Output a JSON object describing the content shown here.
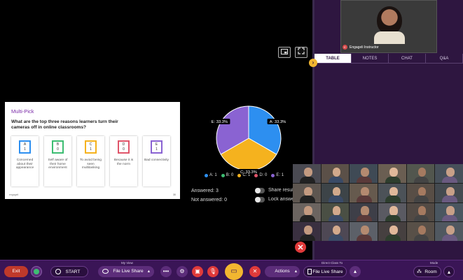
{
  "colors": {
    "background": "#000000",
    "panel": "#2e1640",
    "bottom_bar": "#3a1556",
    "accent_purple": "#7b2ca8",
    "exit_red": "#c0392b",
    "chart_blue": "#2d8ff0",
    "chart_yellow": "#f5b21e",
    "chart_purple": "#8a63d2",
    "chart_green": "#3dbd72",
    "chart_red": "#e0556a"
  },
  "instructor": {
    "name": "Engageli Instructor",
    "initial": "E"
  },
  "tabs": [
    {
      "label": "TABLE",
      "active": true
    },
    {
      "label": "NOTES",
      "active": false
    },
    {
      "label": "CHAT",
      "active": false
    },
    {
      "label": "Q&A",
      "active": false
    }
  ],
  "slide": {
    "title": "Multi-Pick",
    "question": "What are the top three reasons learners turn their cameras off in online classrooms?",
    "cards": [
      {
        "letter": "A",
        "count": "1",
        "text": "Concerned about their appearance",
        "color": "#2d8ff0"
      },
      {
        "letter": "B",
        "count": "0",
        "text": "Self aware of their home environment",
        "color": "#3dbd72"
      },
      {
        "letter": "C",
        "count": "1",
        "text": "To avoid being seen multitasking",
        "color": "#f5b21e"
      },
      {
        "letter": "D",
        "count": "0",
        "text": "Because it is the norm",
        "color": "#e0556a"
      },
      {
        "letter": "E",
        "count": "1",
        "text": "Bad connectivity",
        "color": "#8a63d2"
      }
    ],
    "footer_left": "engageli",
    "footer_right": "30"
  },
  "chart_data": {
    "type": "pie",
    "categories": [
      "A",
      "B",
      "C",
      "D",
      "E"
    ],
    "values": [
      33.3,
      0,
      33.3,
      0,
      33.3
    ],
    "slice_labels": [
      "A: 33.3%",
      "",
      "C: 33.3%",
      "",
      "E: 33.3%"
    ],
    "legend": [
      "A: 1",
      "B: 0",
      "C: 1",
      "D: 0",
      "E: 1"
    ],
    "legend_colors": [
      "#2d8ff0",
      "#3dbd72",
      "#f5b21e",
      "#e0556a",
      "#8a63d2"
    ],
    "legend_position": "bottom"
  },
  "stats": {
    "answered": "Answered: 3",
    "not_answered": "Not answered: 0"
  },
  "toggles": {
    "share": "Share results",
    "lock": "Lock answers"
  },
  "bottom_bar": {
    "exit": "Exit",
    "start": "START",
    "my_view_label": "My View",
    "file_live_share": "File Live Share",
    "actions": "Actions",
    "direct_class_to_label": "Direct Class To",
    "direct_file_live_share": "File Live Share",
    "mode_label": "Mode",
    "mode_value": "Room"
  },
  "icons": {
    "exit": "exit-icon",
    "record": "record-icon",
    "timer": "timer-icon",
    "eye": "eye-icon",
    "more": "more-icon",
    "settings": "gear-icon",
    "camera_off": "camera-off-icon",
    "mic_off": "mic-off-icon",
    "share_screen": "share-screen-icon",
    "disconnect": "disconnect-icon",
    "room": "room-icon"
  }
}
